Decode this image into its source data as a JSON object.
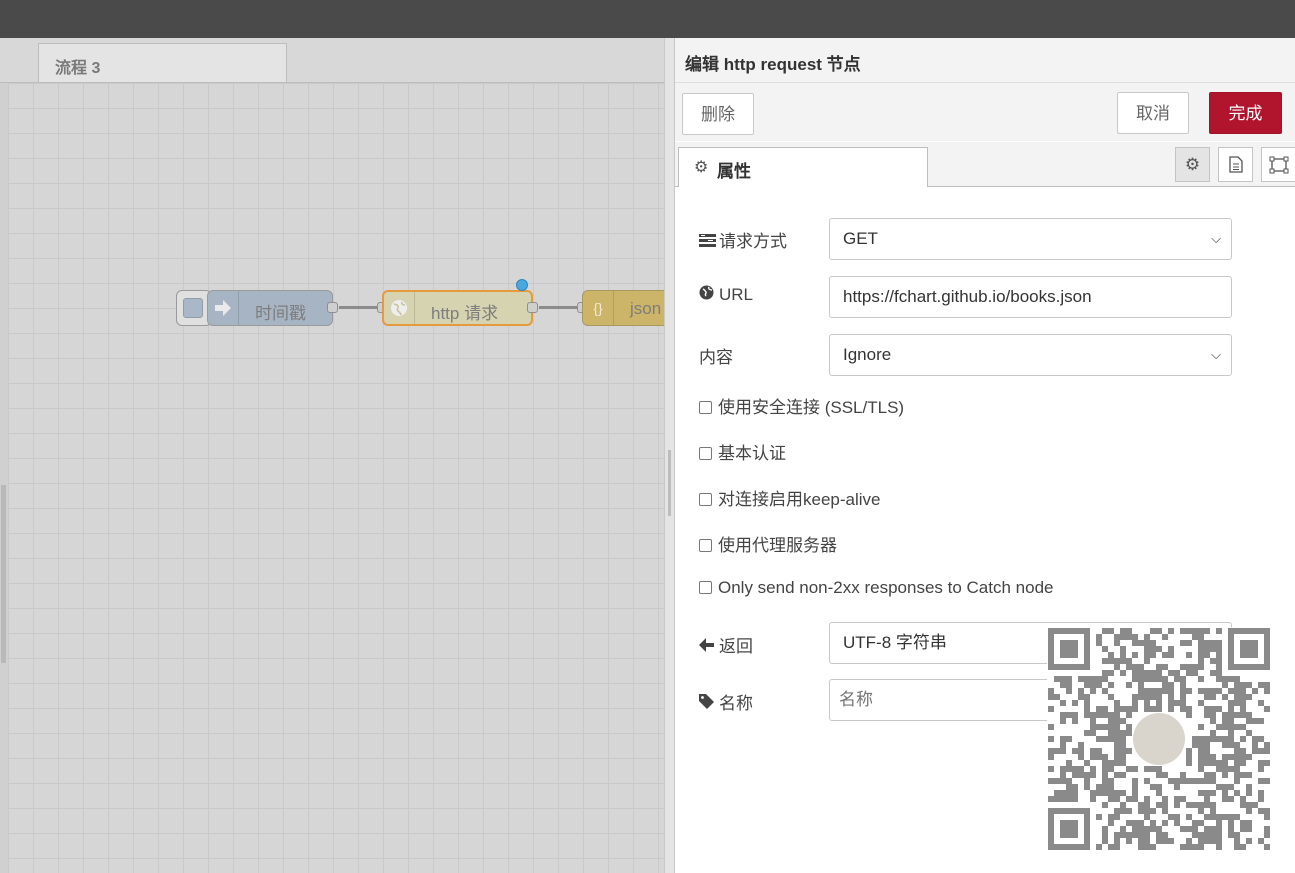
{
  "workspace": {
    "flow_tab": "流程 3",
    "nodes": {
      "inject": {
        "label": "时间戳",
        "icon": "arrow-right-icon"
      },
      "http": {
        "label": "http 请求",
        "icon": "globe-icon",
        "changed_indicator": "#4aa8e0"
      },
      "json": {
        "label": "json",
        "icon": "{}"
      }
    }
  },
  "tray": {
    "title": "编辑 http request 节点",
    "buttons": {
      "delete": "删除",
      "cancel": "取消",
      "done": "完成"
    },
    "tabs": {
      "properties": "属性"
    },
    "tab_icons": [
      "gear-icon",
      "document-icon",
      "frame-icon"
    ],
    "form": {
      "method": {
        "label": "请求方式",
        "value": "GET",
        "icon": "tasks-icon"
      },
      "url": {
        "label": "URL",
        "value": "https://fchart.github.io/books.json",
        "icon": "globe-icon"
      },
      "payload": {
        "label": "内容",
        "value": "Ignore"
      },
      "checkboxes": [
        "使用安全连接 (SSL/TLS)",
        "基本认证",
        "对连接启用keep-alive",
        "使用代理服务器",
        "Only send non-2xx responses to Catch node"
      ],
      "ret": {
        "label": "返回",
        "value": "UTF-8 字符串",
        "icon": "arrow-left-icon"
      },
      "name": {
        "label": "名称",
        "placeholder": "名称",
        "value": "",
        "icon": "tag-icon"
      }
    }
  },
  "colors": {
    "done_button": "#b0152d",
    "inject_node": "#a6bbcf",
    "http_node": "#e7e7ae",
    "http_border": "#ff7f0e",
    "json_node": "#debd5c"
  }
}
